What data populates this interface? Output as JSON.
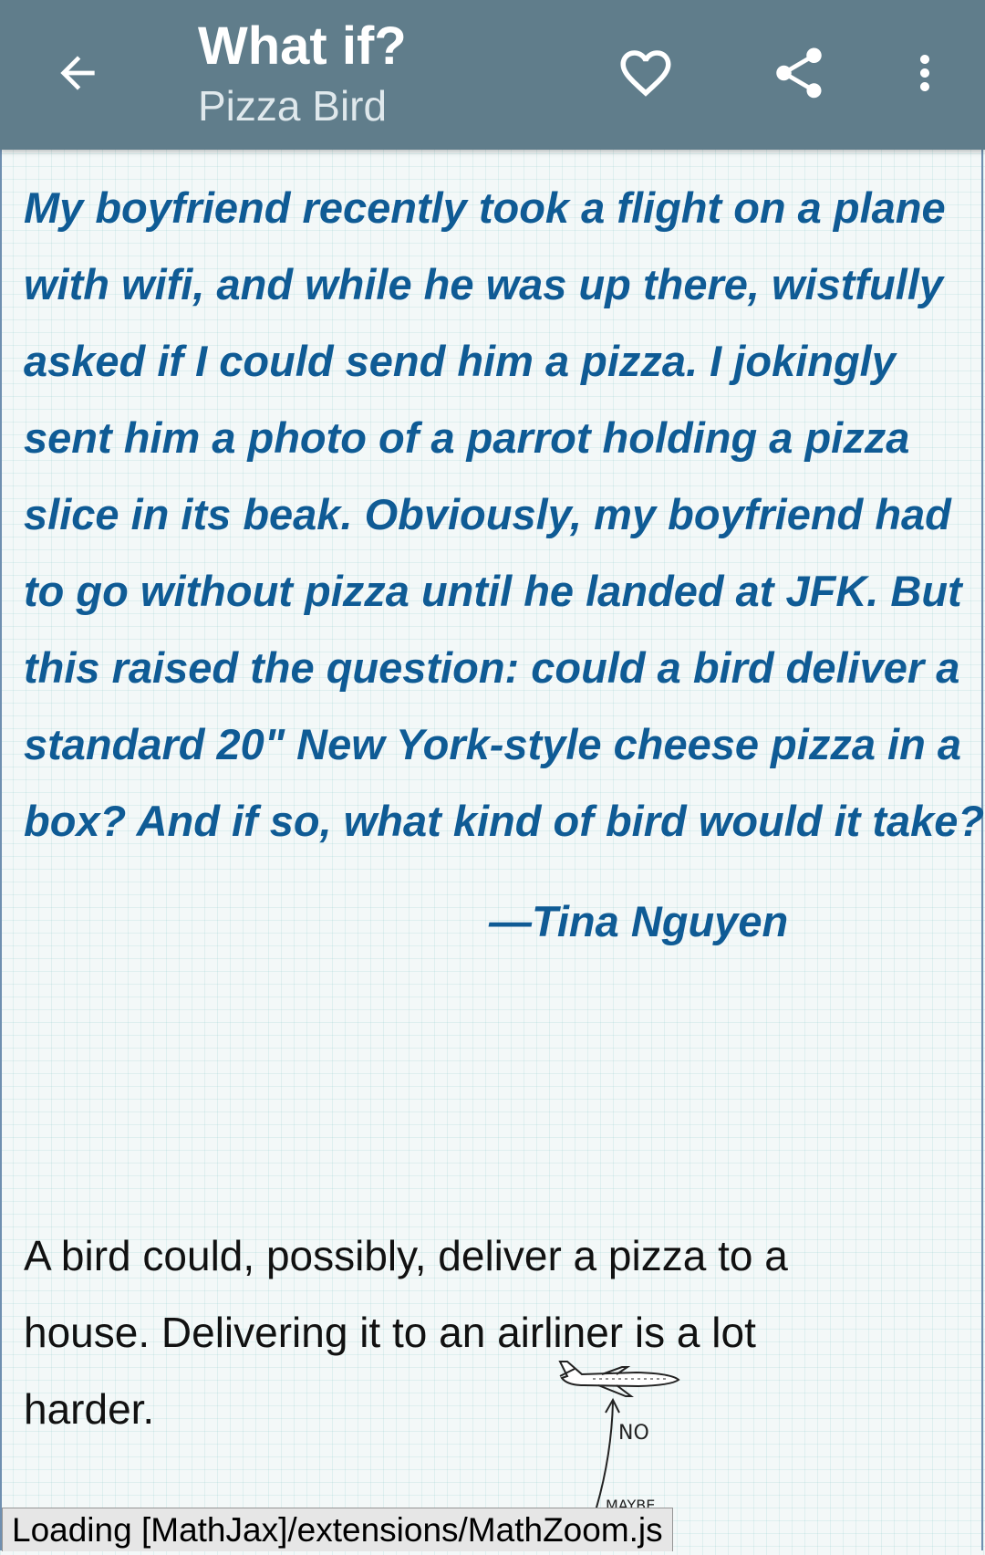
{
  "toolbar": {
    "title": "What if?",
    "subtitle": "Pizza Bird",
    "icons": {
      "back": "arrow-left-icon",
      "favorite": "heart-outline-icon",
      "share": "share-icon",
      "more": "more-vertical-icon"
    },
    "background_color": "#607d8b"
  },
  "article": {
    "question_lines": [
      "My boyfriend recently took a flight on a plane",
      "with wifi, and while he was up there, wistfully",
      "asked if I could send him a pizza. I jokingly",
      "sent him a photo of a parrot holding a pizza",
      "slice in its beak. Obviously, my boyfriend had",
      "to go without pizza until he landed at JFK. But",
      "this raised the question: could a bird deliver a",
      "standard 20\" New York-style cheese pizza in a",
      "box? And if so, what kind of bird would it take?"
    ],
    "attribution": "—Tina Nguyen",
    "answer_lines": [
      "A bird could, possibly, deliver a pizza to a",
      "house. Delivering it to an airliner is a lot",
      "harder."
    ],
    "drawing": {
      "no_label": "NO",
      "maybe_label": "MAYBE"
    },
    "question_color": "#0f5b95"
  },
  "status": {
    "loading_text": "Loading [MathJax]/extensions/MathZoom.js"
  }
}
